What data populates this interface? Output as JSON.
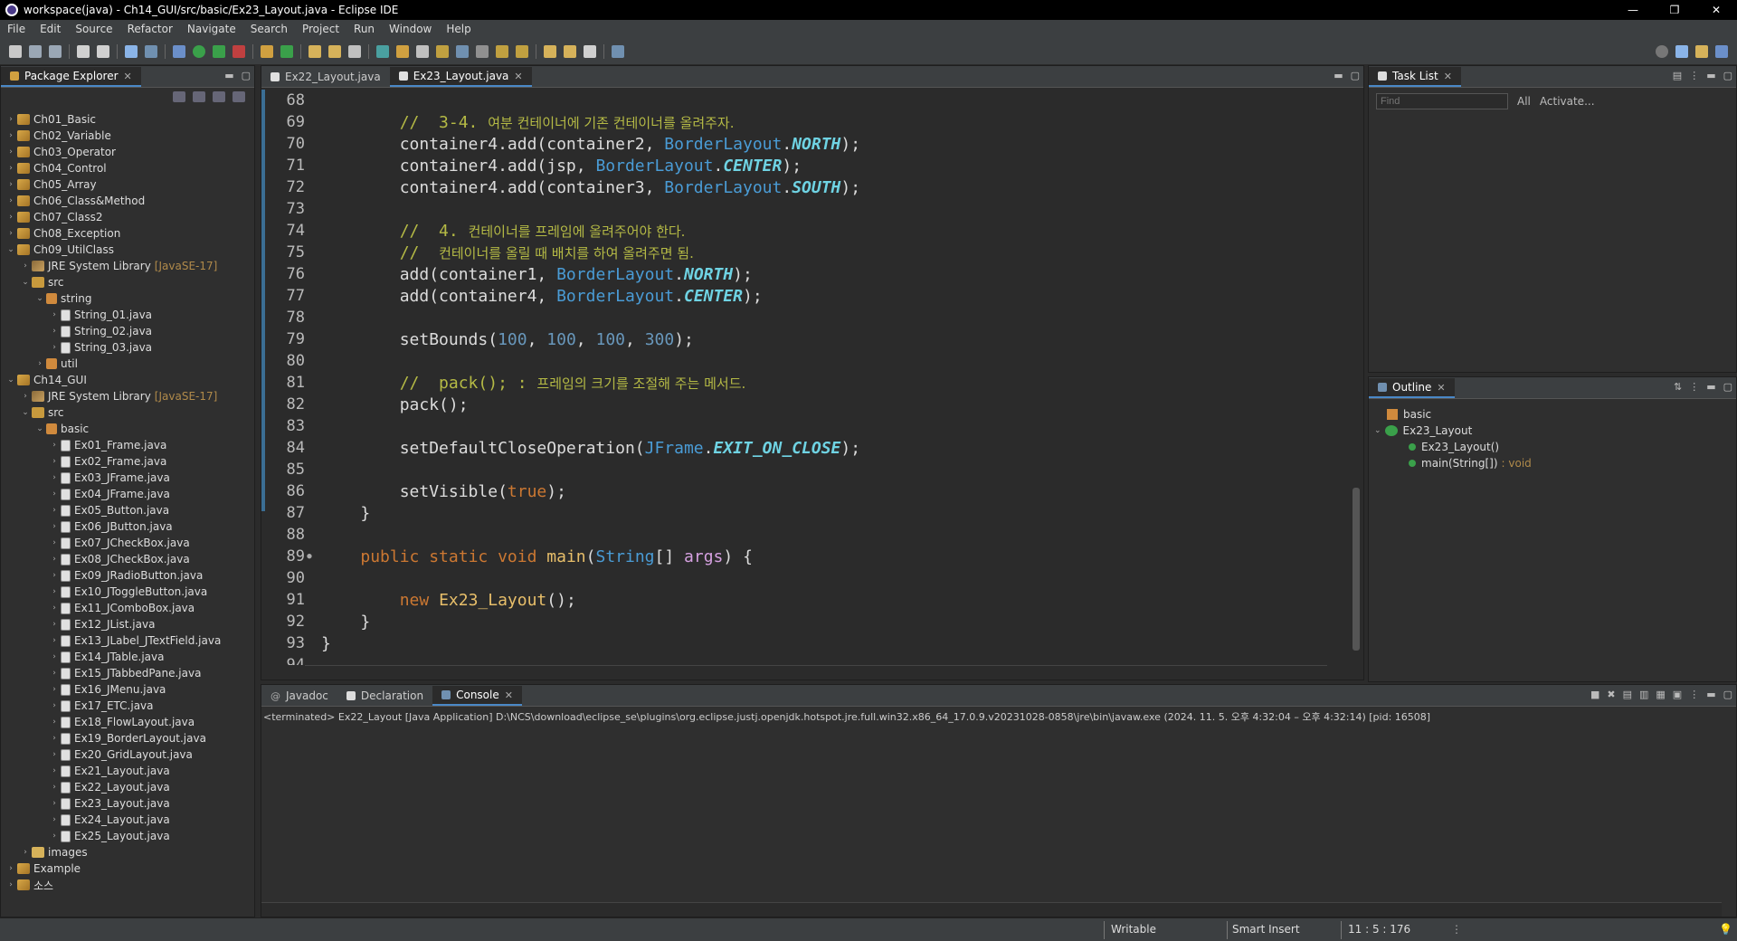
{
  "window": {
    "title": "workspace(java) - Ch14_GUI/src/basic/Ex23_Layout.java - Eclipse IDE",
    "controls": [
      "—",
      "❐",
      "✕"
    ]
  },
  "menu": [
    "File",
    "Edit",
    "Source",
    "Refactor",
    "Navigate",
    "Search",
    "Project",
    "Run",
    "Window",
    "Help"
  ],
  "package_explorer": {
    "title": "Package Explorer",
    "tree": [
      {
        "depth": 0,
        "arrow": "›",
        "icon": "project",
        "label": "Ch01_Basic"
      },
      {
        "depth": 0,
        "arrow": "›",
        "icon": "project",
        "label": "Ch02_Variable"
      },
      {
        "depth": 0,
        "arrow": "›",
        "icon": "project",
        "label": "Ch03_Operator"
      },
      {
        "depth": 0,
        "arrow": "›",
        "icon": "project",
        "label": "Ch04_Control"
      },
      {
        "depth": 0,
        "arrow": "›",
        "icon": "project",
        "label": "Ch05_Array"
      },
      {
        "depth": 0,
        "arrow": "›",
        "icon": "project",
        "label": "Ch06_Class&Method"
      },
      {
        "depth": 0,
        "arrow": "›",
        "icon": "project",
        "label": "Ch07_Class2"
      },
      {
        "depth": 0,
        "arrow": "›",
        "icon": "project",
        "label": "Ch08_Exception"
      },
      {
        "depth": 0,
        "arrow": "⌄",
        "icon": "project",
        "label": "Ch09_UtilClass"
      },
      {
        "depth": 1,
        "arrow": "›",
        "icon": "lib",
        "label": "JRE System Library",
        "extra": "[JavaSE-17]"
      },
      {
        "depth": 1,
        "arrow": "⌄",
        "icon": "src",
        "label": "src"
      },
      {
        "depth": 2,
        "arrow": "⌄",
        "icon": "pkg",
        "label": "string"
      },
      {
        "depth": 3,
        "arrow": "›",
        "icon": "java",
        "label": "String_01.java"
      },
      {
        "depth": 3,
        "arrow": "›",
        "icon": "java",
        "label": "String_02.java"
      },
      {
        "depth": 3,
        "arrow": "›",
        "icon": "java",
        "label": "String_03.java"
      },
      {
        "depth": 2,
        "arrow": "›",
        "icon": "pkg",
        "label": "util"
      },
      {
        "depth": 0,
        "arrow": "⌄",
        "icon": "project",
        "label": "Ch14_GUI"
      },
      {
        "depth": 1,
        "arrow": "›",
        "icon": "lib",
        "label": "JRE System Library",
        "extra": "[JavaSE-17]"
      },
      {
        "depth": 1,
        "arrow": "⌄",
        "icon": "src",
        "label": "src"
      },
      {
        "depth": 2,
        "arrow": "⌄",
        "icon": "pkg",
        "label": "basic"
      },
      {
        "depth": 3,
        "arrow": "›",
        "icon": "java",
        "label": "Ex01_Frame.java"
      },
      {
        "depth": 3,
        "arrow": "›",
        "icon": "java",
        "label": "Ex02_Frame.java"
      },
      {
        "depth": 3,
        "arrow": "›",
        "icon": "java",
        "label": "Ex03_JFrame.java"
      },
      {
        "depth": 3,
        "arrow": "›",
        "icon": "java",
        "label": "Ex04_JFrame.java"
      },
      {
        "depth": 3,
        "arrow": "›",
        "icon": "java",
        "label": "Ex05_Button.java"
      },
      {
        "depth": 3,
        "arrow": "›",
        "icon": "java",
        "label": "Ex06_JButton.java"
      },
      {
        "depth": 3,
        "arrow": "›",
        "icon": "java",
        "label": "Ex07_JCheckBox.java"
      },
      {
        "depth": 3,
        "arrow": "›",
        "icon": "java",
        "label": "Ex08_JCheckBox.java"
      },
      {
        "depth": 3,
        "arrow": "›",
        "icon": "java",
        "label": "Ex09_JRadioButton.java"
      },
      {
        "depth": 3,
        "arrow": "›",
        "icon": "java",
        "label": "Ex10_JToggleButton.java"
      },
      {
        "depth": 3,
        "arrow": "›",
        "icon": "java",
        "label": "Ex11_JComboBox.java"
      },
      {
        "depth": 3,
        "arrow": "›",
        "icon": "java",
        "label": "Ex12_JList.java"
      },
      {
        "depth": 3,
        "arrow": "›",
        "icon": "java",
        "label": "Ex13_JLabel_JTextField.java"
      },
      {
        "depth": 3,
        "arrow": "›",
        "icon": "java",
        "label": "Ex14_JTable.java"
      },
      {
        "depth": 3,
        "arrow": "›",
        "icon": "java",
        "label": "Ex15_JTabbedPane.java"
      },
      {
        "depth": 3,
        "arrow": "›",
        "icon": "java",
        "label": "Ex16_JMenu.java"
      },
      {
        "depth": 3,
        "arrow": "›",
        "icon": "java",
        "label": "Ex17_ETC.java"
      },
      {
        "depth": 3,
        "arrow": "›",
        "icon": "java",
        "label": "Ex18_FlowLayout.java"
      },
      {
        "depth": 3,
        "arrow": "›",
        "icon": "java",
        "label": "Ex19_BorderLayout.java"
      },
      {
        "depth": 3,
        "arrow": "›",
        "icon": "java",
        "label": "Ex20_GridLayout.java"
      },
      {
        "depth": 3,
        "arrow": "›",
        "icon": "java",
        "label": "Ex21_Layout.java"
      },
      {
        "depth": 3,
        "arrow": "›",
        "icon": "java",
        "label": "Ex22_Layout.java"
      },
      {
        "depth": 3,
        "arrow": "›",
        "icon": "java",
        "label": "Ex23_Layout.java"
      },
      {
        "depth": 3,
        "arrow": "›",
        "icon": "java",
        "label": "Ex24_Layout.java"
      },
      {
        "depth": 3,
        "arrow": "›",
        "icon": "java",
        "label": "Ex25_Layout.java"
      },
      {
        "depth": 1,
        "arrow": "›",
        "icon": "folder",
        "label": "images"
      },
      {
        "depth": 0,
        "arrow": "›",
        "icon": "project",
        "label": "Example"
      },
      {
        "depth": 0,
        "arrow": "›",
        "icon": "project",
        "label": "소스"
      }
    ]
  },
  "editor": {
    "tabs": [
      {
        "label": "Ex22_Layout.java",
        "active": false
      },
      {
        "label": "Ex23_Layout.java",
        "active": true
      }
    ],
    "lines": [
      {
        "n": "68",
        "html": ""
      },
      {
        "n": "69",
        "html": "        <span class=\"cmt\">//  3-4. <span class=\"korean\">여분 컨테이너에 기존 컨테이너를 올려주자.</span></span>"
      },
      {
        "n": "70",
        "html": "        container4.add(container2, <span class=\"cls\">BorderLayout</span>.<span class=\"const\">NORTH</span>);"
      },
      {
        "n": "71",
        "html": "        container4.add(jsp, <span class=\"cls\">BorderLayout</span>.<span class=\"const\">CENTER</span>);"
      },
      {
        "n": "72",
        "html": "        container4.add(container3, <span class=\"cls\">BorderLayout</span>.<span class=\"const\">SOUTH</span>);"
      },
      {
        "n": "73",
        "html": ""
      },
      {
        "n": "74",
        "html": "        <span class=\"cmt\">//  4. <span class=\"korean\">컨테이너를 프레임에 올려주어야 한다.</span></span>"
      },
      {
        "n": "75",
        "html": "        <span class=\"cmt\">//  <span class=\"korean\">컨테이너를 올릴 때 배치를 하여 올려주면 됨.</span></span>"
      },
      {
        "n": "76",
        "html": "        add(container1, <span class=\"cls\">BorderLayout</span>.<span class=\"const\">NORTH</span>);"
      },
      {
        "n": "77",
        "html": "        add(container4, <span class=\"cls\">BorderLayout</span>.<span class=\"const\">CENTER</span>);"
      },
      {
        "n": "78",
        "html": ""
      },
      {
        "n": "79",
        "html": "        setBounds(<span class=\"num\">100</span>, <span class=\"num\">100</span>, <span class=\"num\">100</span>, <span class=\"num\">300</span>);"
      },
      {
        "n": "80",
        "html": ""
      },
      {
        "n": "81",
        "html": "        <span class=\"cmt\">//  pack(); : <span class=\"korean\">프레임의 크기를 조절해 주는 메서드.</span></span>"
      },
      {
        "n": "82",
        "html": "        pack();"
      },
      {
        "n": "83",
        "html": ""
      },
      {
        "n": "84",
        "html": "        setDefaultCloseOperation(<span class=\"cls\">JFrame</span>.<span class=\"const\">EXIT_ON_CLOSE</span>);"
      },
      {
        "n": "85",
        "html": ""
      },
      {
        "n": "86",
        "html": "        setVisible(<span class=\"kw\">true</span>);"
      },
      {
        "n": "87",
        "html": "    }"
      },
      {
        "n": "88",
        "html": ""
      },
      {
        "n": "89",
        "html": "    <span class=\"kw\">public static void</span> <span class=\"mth\">main</span>(<span class=\"cls\">String</span>[] <span class=\"param\">args</span>) {",
        "mark": "●"
      },
      {
        "n": "90",
        "html": ""
      },
      {
        "n": "91",
        "html": "        <span class=\"kw\">new</span> <span class=\"mth\">Ex23_Layout</span>();"
      },
      {
        "n": "92",
        "html": "    }"
      },
      {
        "n": "93",
        "html": "}"
      },
      {
        "n": "94",
        "html": ""
      }
    ]
  },
  "task_list": {
    "title": "Task List",
    "find_placeholder": "Find",
    "all_label": "All",
    "activate_label": "Activate..."
  },
  "outline": {
    "title": "Outline",
    "items": [
      {
        "label": "basic",
        "extra": ""
      },
      {
        "label": "Ex23_Layout",
        "extra": ""
      },
      {
        "label": "Ex23_Layout()",
        "extra": ""
      },
      {
        "label": "main(String[])",
        "extra": ": void"
      }
    ]
  },
  "console": {
    "tabs": [
      {
        "label": "Javadoc",
        "active": false
      },
      {
        "label": "Declaration",
        "active": false
      },
      {
        "label": "Console",
        "active": true
      }
    ],
    "terminated": "<terminated> Ex22_Layout [Java Application] D:\\NCS\\download\\eclipse_se\\plugins\\org.eclipse.justj.openjdk.hotspot.jre.full.win32.x86_64_17.0.9.v20231028-0858\\jre\\bin\\javaw.exe  (2024. 11. 5. 오후 4:32:04 – 오후 4:32:14) [pid: 16508]"
  },
  "status": {
    "writable": "Writable",
    "insert_mode": "Smart Insert",
    "position": "11 : 5 : 176"
  },
  "colors": {
    "keyword": "#cc7832",
    "comment": "#b5ba45",
    "class": "#4a9cd6",
    "constant": "#6fd3e3",
    "number": "#6897bb"
  }
}
